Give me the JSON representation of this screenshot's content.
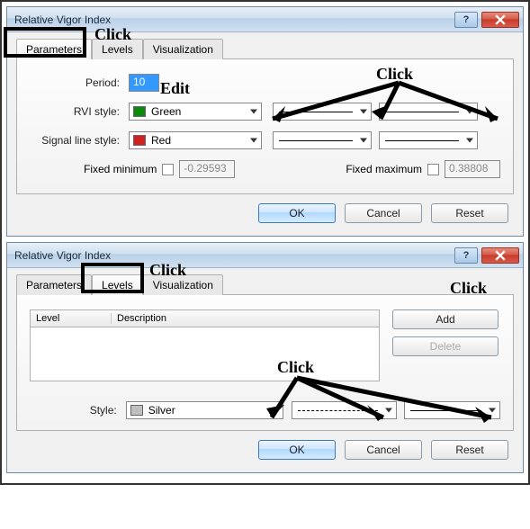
{
  "dialog1": {
    "title": "Relative Vigor Index",
    "tabs": {
      "parameters": "Parameters",
      "levels": "Levels",
      "visualization": "Visualization"
    },
    "labels": {
      "period": "Period:",
      "rvi_style": "RVI style:",
      "signal_style": "Signal line style:",
      "fixed_min": "Fixed minimum",
      "fixed_max": "Fixed maximum"
    },
    "values": {
      "period": "10",
      "rvi_color": "Green",
      "signal_color": "Red",
      "fixed_min": "-0.29593",
      "fixed_max": "0.38808"
    },
    "buttons": {
      "ok": "OK",
      "cancel": "Cancel",
      "reset": "Reset"
    },
    "help": "?"
  },
  "dialog2": {
    "title": "Relative Vigor Index",
    "tabs": {
      "parameters": "Parameters",
      "levels": "Levels",
      "visualization": "Visualization"
    },
    "columns": {
      "level": "Level",
      "description": "Description"
    },
    "labels": {
      "style": "Style:"
    },
    "values": {
      "style_color": "Silver"
    },
    "buttons": {
      "add": "Add",
      "delete": "Delete",
      "ok": "OK",
      "cancel": "Cancel",
      "reset": "Reset"
    },
    "help": "?"
  },
  "annotations": {
    "click": "Click",
    "edit": "Edit"
  }
}
